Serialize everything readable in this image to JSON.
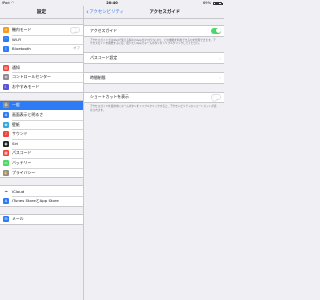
{
  "status_bar": {
    "carrier": "iPad",
    "time": "20:40",
    "battery": "69%"
  },
  "sidebar": {
    "title": "設定",
    "groups": [
      [
        {
          "label": "機内モード",
          "icon": "airplane-icon",
          "color": "#f79a1e",
          "glyph": "✈",
          "accessory": "toggle"
        },
        {
          "label": "Wi-Fi",
          "icon": "wifi-icon",
          "color": "#2d7cf6",
          "glyph": "◠",
          "value": ""
        },
        {
          "label": "Bluetooth",
          "icon": "bluetooth-icon",
          "color": "#2d7cf6",
          "glyph": "ᛒ",
          "value": "オフ"
        }
      ],
      [
        {
          "label": "通知",
          "icon": "notifications-icon",
          "color": "#f0453a",
          "glyph": "▤"
        },
        {
          "label": "コントロールセンター",
          "icon": "control-center-icon",
          "color": "#8e8e93",
          "glyph": "≡"
        },
        {
          "label": "おやすみモード",
          "icon": "moon-icon",
          "color": "#5856d6",
          "glyph": "☾"
        }
      ],
      [
        {
          "label": "一般",
          "icon": "gear-icon",
          "color": "#8e8e93",
          "glyph": "⚙",
          "selected": true
        },
        {
          "label": "画面表示と明るさ",
          "icon": "display-icon",
          "color": "#2d7cf6",
          "glyph": "A"
        },
        {
          "label": "壁紙",
          "icon": "wallpaper-icon",
          "color": "#35aadc",
          "glyph": "❀"
        },
        {
          "label": "サウンド",
          "icon": "sound-icon",
          "color": "#f0453a",
          "glyph": "♪"
        },
        {
          "label": "Siri",
          "icon": "siri-icon",
          "color": "#222222",
          "glyph": "◉"
        },
        {
          "label": "パスコード",
          "icon": "passcode-icon",
          "color": "#f0453a",
          "glyph": "▦"
        },
        {
          "label": "バッテリー",
          "icon": "battery-icon",
          "color": "#4cd964",
          "glyph": "▭"
        },
        {
          "label": "プライバシー",
          "icon": "privacy-icon",
          "color": "#8e8e93",
          "glyph": "✋"
        }
      ],
      [
        {
          "label": "iCloud",
          "icon": "icloud-icon",
          "color": "#ffffff",
          "glyph": "☁",
          "glyph_color": "#2d7cf6"
        },
        {
          "label": "iTunes StoreとApp Store",
          "icon": "app-store-icon",
          "color": "#2d7cf6",
          "glyph": "A"
        }
      ],
      [
        {
          "label": "メール",
          "icon": "mail-icon",
          "color": "#2d7cf6",
          "glyph": "✉"
        }
      ]
    ]
  },
  "detail": {
    "back_label": "アクセシビリティ",
    "title": "アクセスガイド",
    "guided_access": {
      "label": "アクセスガイド",
      "on": true,
      "footnote": "アクセスガイドではiPadで使える個々のAppが1つだけになり、どの機能を利用できるかを管理できます。アクセスガイドを開始するには、使いたいAppでホームボタンをトリプルクリックしてください。"
    },
    "passcode_settings": {
      "label": "パスコード設定"
    },
    "time_limits": {
      "label": "時間制限"
    },
    "shortcut": {
      "label": "ショートカットを表示",
      "on": false,
      "footnote": "アクセスガイドを使用中にホームボタンをトリプルクリックすると、アクセシビリティのショートカットが表示されます。"
    }
  }
}
